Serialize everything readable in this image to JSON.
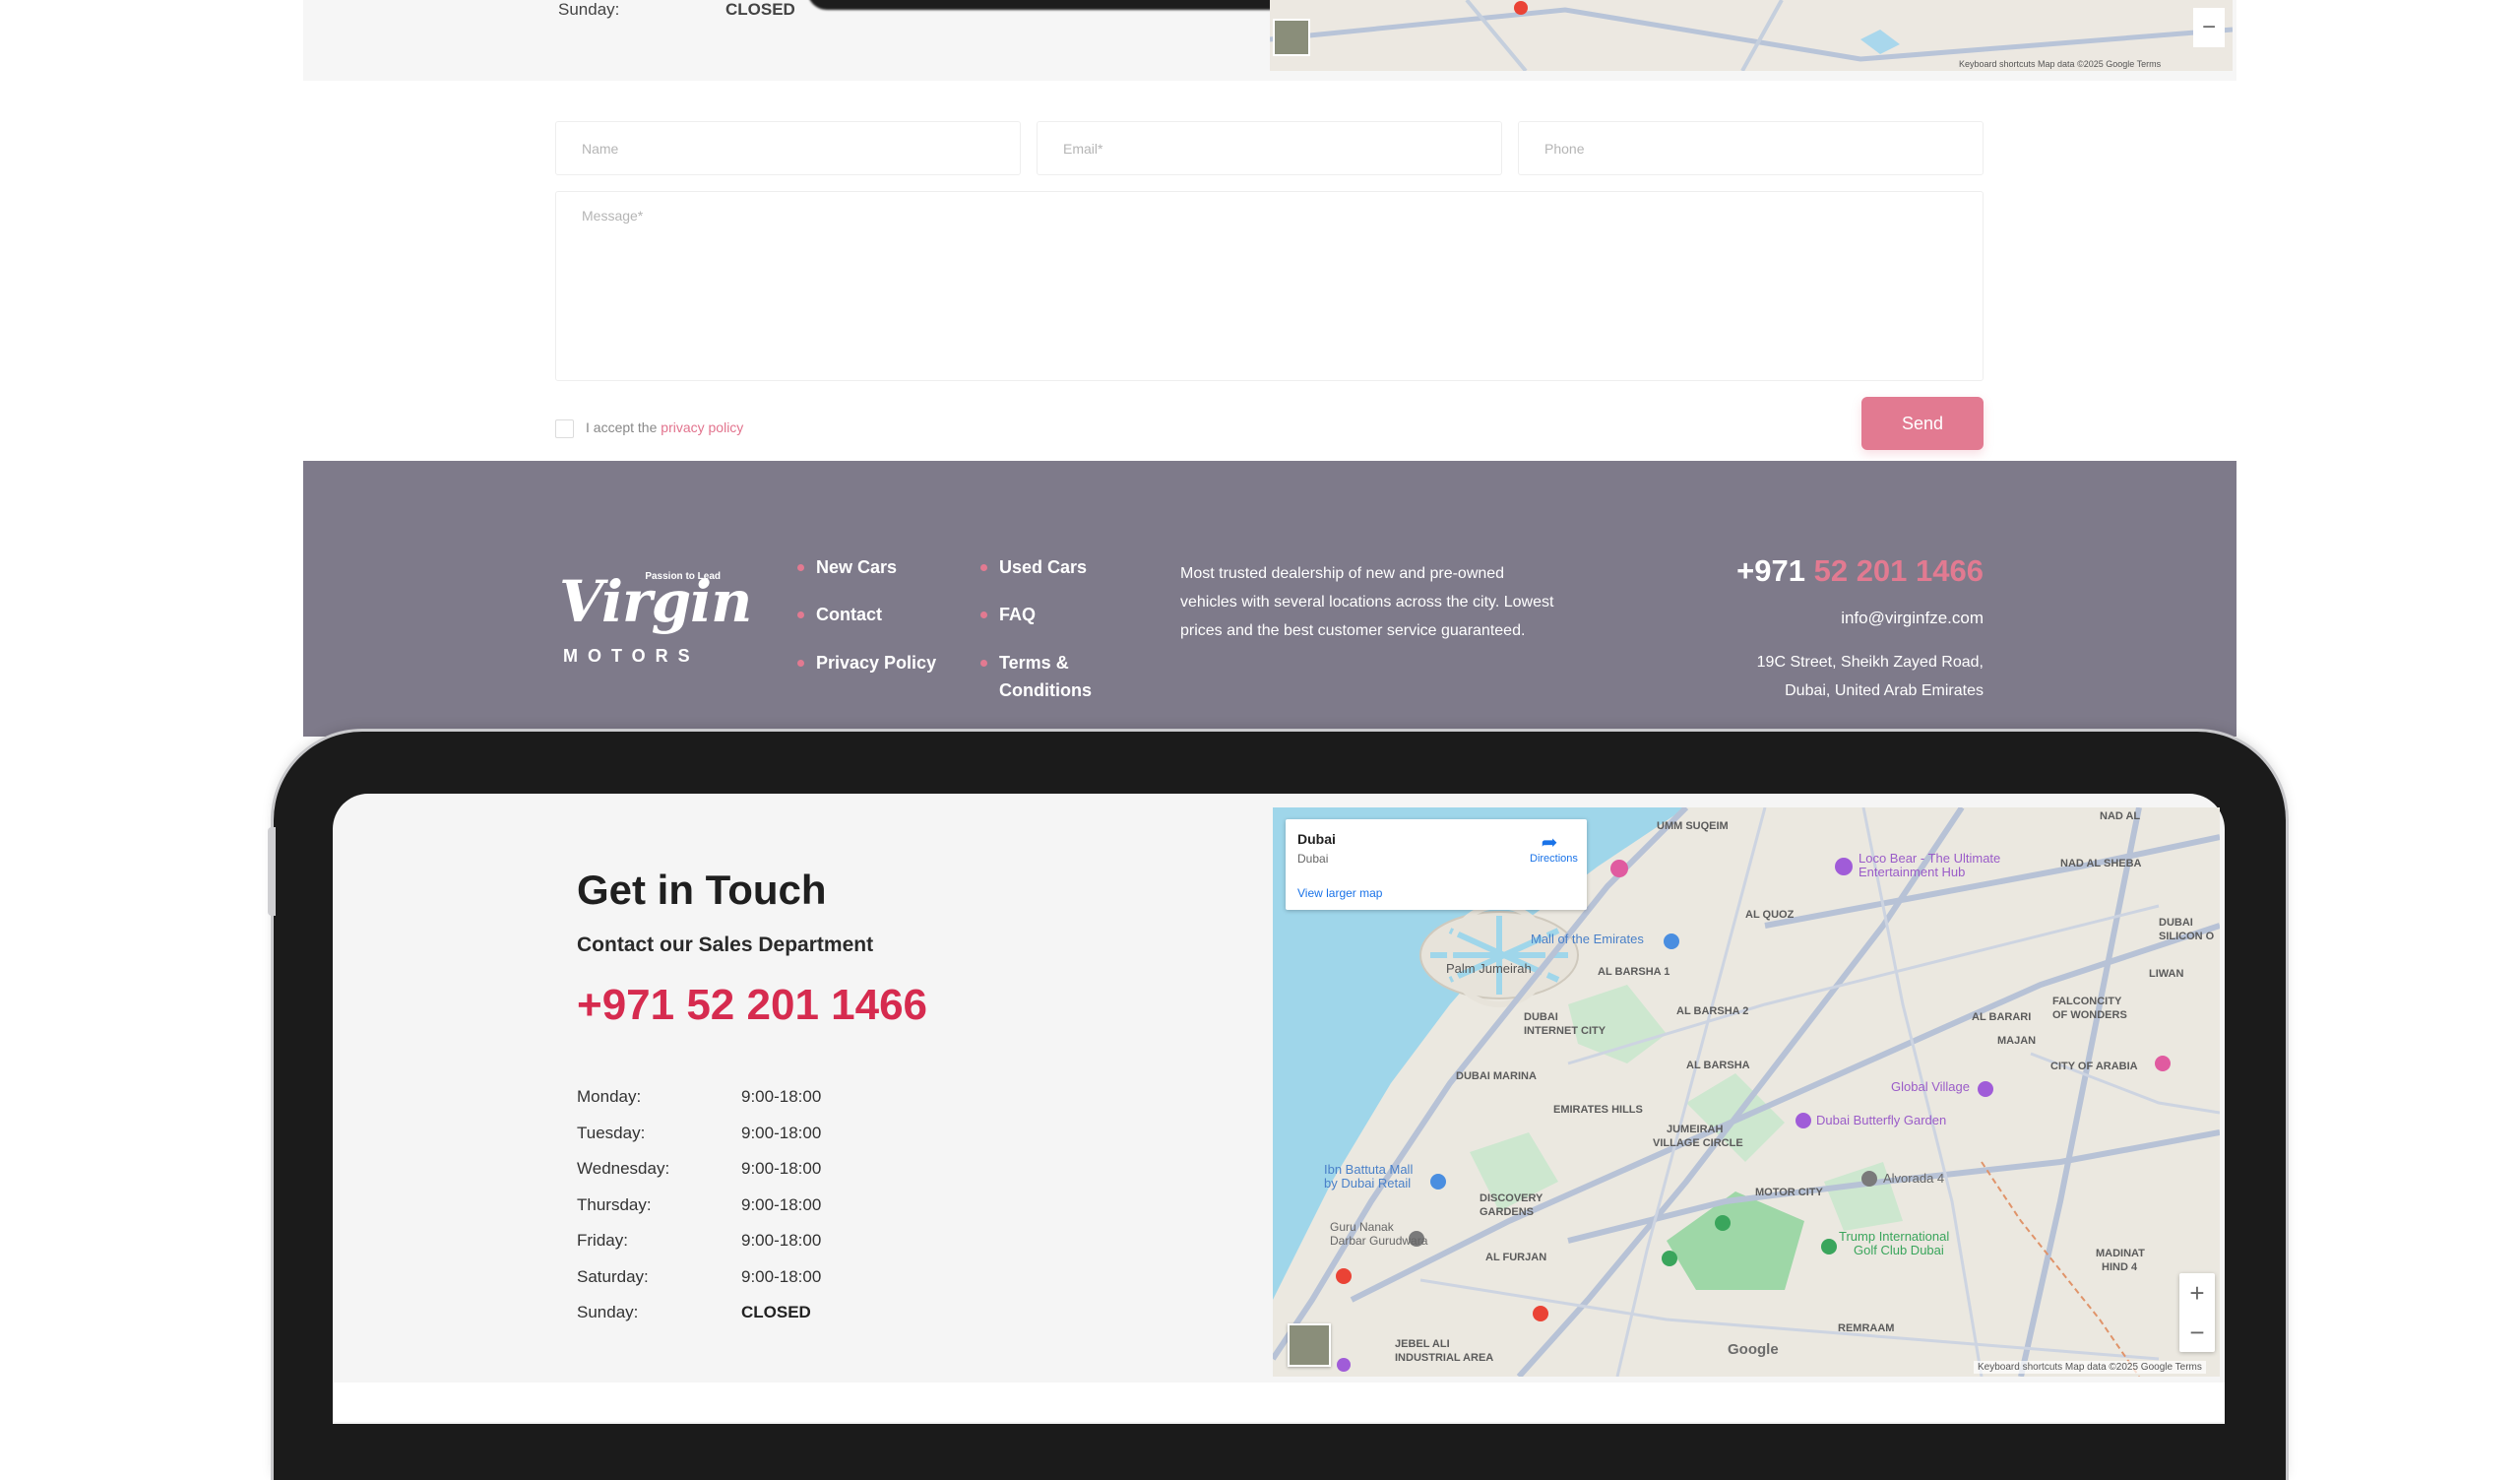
{
  "top_section": {
    "sunday_label": "Sunday:",
    "sunday_value": "CLOSED",
    "map_attribution": "Keyboard shortcuts   Map data ©2025 Google   Terms"
  },
  "form": {
    "name_placeholder": "Name",
    "email_placeholder": "Email*",
    "phone_placeholder": "Phone",
    "message_placeholder": "Message*",
    "accept_text": "I accept the",
    "privacy_link": "privacy policy",
    "send_label": "Send"
  },
  "footer": {
    "logo": {
      "tagline": "Passion to Lead",
      "script": "Virgin",
      "motors": "MOTORS"
    },
    "links_col1": [
      "New Cars",
      "Contact",
      "Privacy Policy"
    ],
    "links_col2": [
      "Used Cars",
      "FAQ",
      "Terms & Conditions"
    ],
    "description": "Most trusted dealership of new and pre-owned vehicles with several locations across the city. Lowest prices and the best customer service guaranteed.",
    "phone_prefix": "+971",
    "phone_number": "52 201 1466",
    "email": "info@virginfze.com",
    "address_line1": "19C Street, Sheikh Zayed Road,",
    "address_line2": "Dubai, United Arab Emirates",
    "colors": {
      "footer_bg": "#7e7a8a",
      "accent": "#e27a91"
    }
  },
  "contact": {
    "title": "Get in Touch",
    "subtitle": "Contact our Sales Department",
    "phone": "+971 52 201 1466",
    "hours": [
      {
        "day": "Monday:",
        "time": "9:00-18:00"
      },
      {
        "day": "Tuesday:",
        "time": "9:00-18:00"
      },
      {
        "day": "Wednesday:",
        "time": "9:00-18:00"
      },
      {
        "day": "Thursday:",
        "time": "9:00-18:00"
      },
      {
        "day": "Friday:",
        "time": "9:00-18:00"
      },
      {
        "day": "Saturday:",
        "time": "9:00-18:00"
      },
      {
        "day": "Sunday:",
        "time": "CLOSED"
      }
    ],
    "accent_color": "#d62b4f"
  },
  "map": {
    "card_title": "Dubai",
    "card_subtitle": "Dubai",
    "directions_label": "Directions",
    "larger_map_link": "View larger map",
    "zoom_in": "+",
    "zoom_out": "−",
    "google_logo": "Google",
    "attribution": "Keyboard shortcuts   Map data ©2025 Google   Terms",
    "places": [
      "Loco Bear - The Ultimate Entertainment Hub",
      "Mall of the Emirates",
      "Palm Jumeirah",
      "AL QUOZ",
      "AL BARSHA 1",
      "AL BARSHA 2",
      "DUBAI INTERNET CITY",
      "AL BARSHA",
      "DUBAI MARINA",
      "EMIRATES HILLS",
      "JUMEIRAH VILLAGE CIRCLE",
      "Global Village",
      "Dubai Butterfly Garden",
      "Ibn Battuta Mall by Dubai Retail",
      "DISCOVERY GARDENS",
      "MOTOR CITY",
      "Alvorada 4",
      "Guru Nanak Darbar Gurudwara",
      "Trump International Golf Club Dubai",
      "AL FURJAN",
      "JEBEL ALI INDUSTRIAL AREA",
      "REMRAAM",
      "MADINAT HIND 4",
      "AL BARARI",
      "FALCONCITY OF WONDERS",
      "MAJAN",
      "CITY OF ARABIA",
      "UMM SUQEIM",
      "NAD AL SHEBA",
      "LIWAN",
      "DUBAI SILICON OASIS"
    ]
  }
}
